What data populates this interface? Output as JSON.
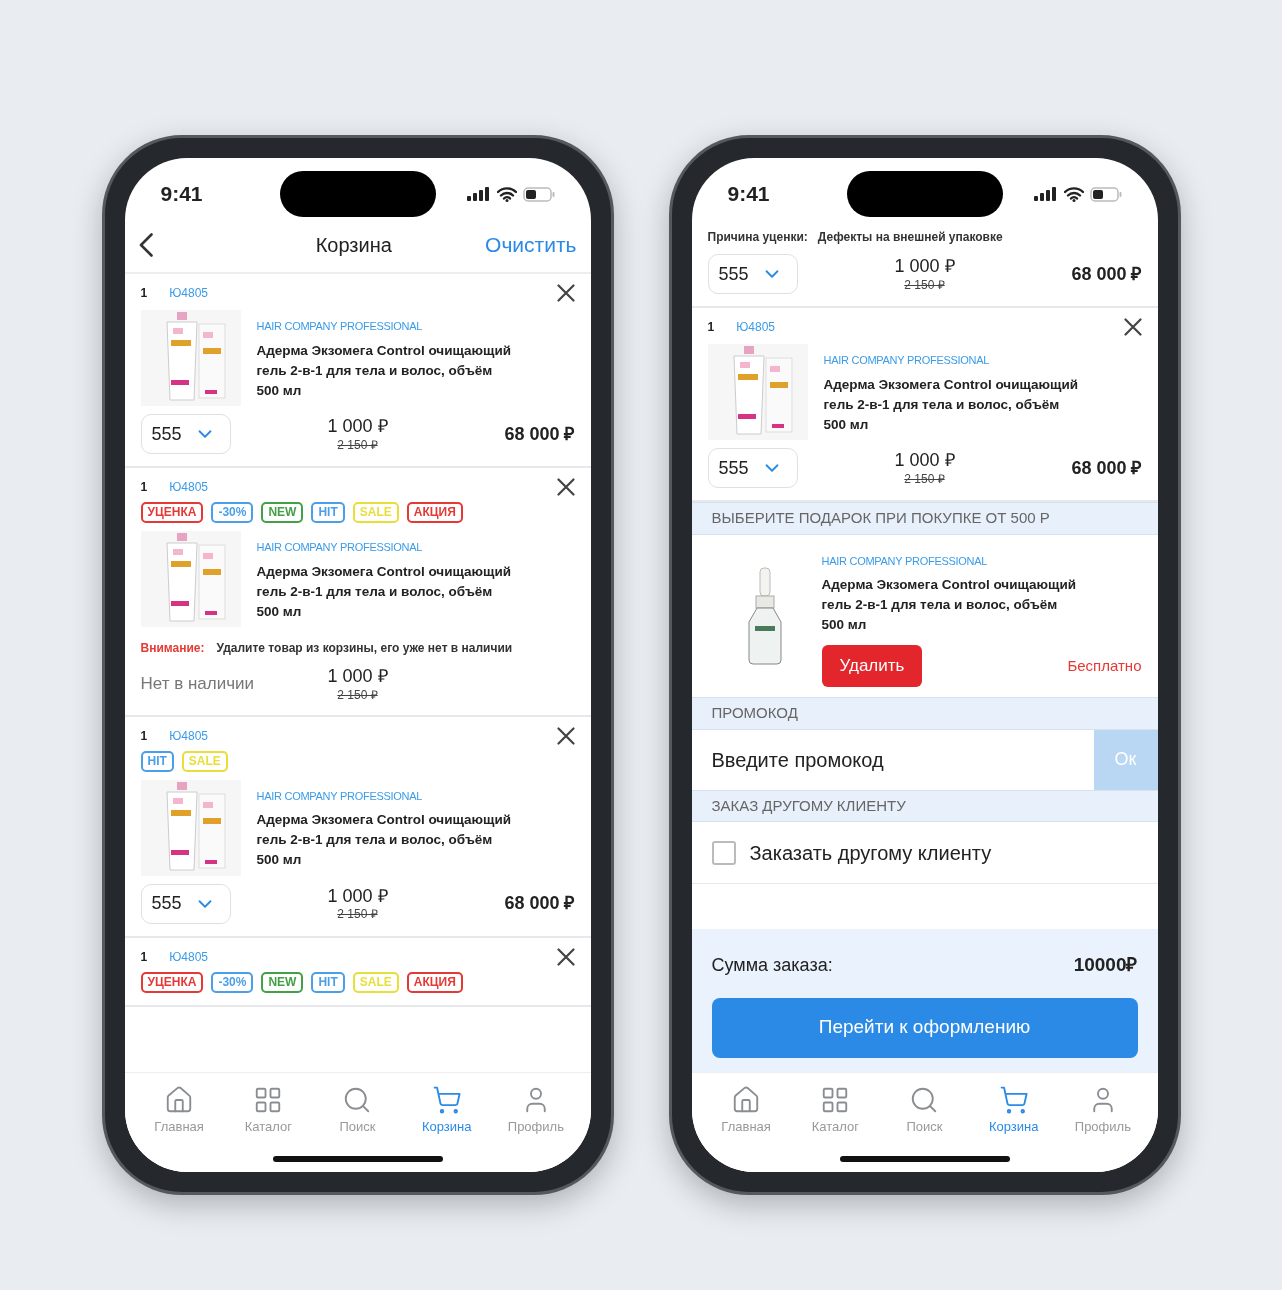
{
  "phones": [
    {
      "status": {
        "time": "9:41"
      },
      "header": {
        "title": "Корзина",
        "action": "Очистить"
      },
      "sections": [
        {
          "kind": "item",
          "number": "1",
          "code": "Ю4805",
          "brand": "HAIR COMPANY PROFESSIONAL",
          "name": "Адерма Экзомега Control очищающий гель 2-в-1 для тела и волос, объём 500 мл",
          "quantity": "555",
          "price": "1 000 ₽",
          "old_price": "2 150 ₽",
          "total": "68 000 ₽"
        },
        {
          "kind": "item",
          "number": "1",
          "code": "Ю4805",
          "tags": [
            {
              "label": "УЦЕНКА",
              "color": "#e53935"
            },
            {
              "label": "-30%",
              "color": "#4a9fe8"
            },
            {
              "label": "NEW",
              "color": "#43a047"
            },
            {
              "label": "HIT",
              "color": "#4a9fe8"
            },
            {
              "label": "SALE",
              "color": "#e8df3a"
            },
            {
              "label": "АКЦИЯ",
              "color": "#e53935"
            }
          ],
          "brand": "HAIR COMPANY PROFESSIONAL",
          "name": "Адерма Экзомега Control очищающий гель 2-в-1 для тела и волос, объём 500 мл",
          "warning_label": "Внимание:",
          "warning": "Удалите товар из корзины, его уже нет в наличии",
          "availability": "Нет в наличии",
          "price": "1 000 ₽",
          "old_price": "2 150 ₽"
        },
        {
          "kind": "item",
          "number": "1",
          "code": "Ю4805",
          "tags": [
            {
              "label": "HIT",
              "color": "#4a9fe8"
            },
            {
              "label": "SALE",
              "color": "#e8df3a"
            }
          ],
          "brand": "HAIR COMPANY PROFESSIONAL",
          "name": "Адерма Экзомега Control очищающий гель 2-в-1 для тела и волос, объём 500 мл",
          "quantity": "555",
          "price": "1 000 ₽",
          "old_price": "2 150 ₽",
          "total": "68 000 ₽"
        },
        {
          "kind": "item",
          "number": "1",
          "code": "Ю4805",
          "tags": [
            {
              "label": "УЦЕНКА",
              "color": "#e53935"
            },
            {
              "label": "-30%",
              "color": "#4a9fe8"
            },
            {
              "label": "NEW",
              "color": "#43a047"
            },
            {
              "label": "HIT",
              "color": "#4a9fe8"
            },
            {
              "label": "SALE",
              "color": "#e8df3a"
            },
            {
              "label": "АКЦИЯ",
              "color": "#e53935"
            }
          ]
        }
      ],
      "tab_bar": [
        {
          "label": "Главная",
          "selected": false
        },
        {
          "label": "Каталог",
          "selected": false
        },
        {
          "label": "Поиск",
          "selected": false
        },
        {
          "label": "Корзина",
          "selected": true
        },
        {
          "label": "Профиль",
          "selected": false
        }
      ]
    },
    {
      "status": {
        "time": "9:41"
      },
      "sections": [
        {
          "kind": "item",
          "reason_label": "Причина уценки:",
          "reason": "Дефекты на внешней упаковке",
          "quantity": "555",
          "price": "1 000 ₽",
          "old_price": "2 150 ₽",
          "total": "68 000 ₽"
        },
        {
          "kind": "item",
          "number": "1",
          "code": "Ю4805",
          "brand": "HAIR COMPANY PROFESSIONAL",
          "name": "Адерма Экзомега Control очищающий гель 2-в-1 для тела и волос, объём 500 мл",
          "quantity": "555",
          "price": "1 000 ₽",
          "old_price": "2 150 ₽",
          "total": "68 000 ₽"
        },
        {
          "kind": "gift",
          "heading": "ВЫБЕРИТЕ ПОДАРОК ПРИ ПОКУПКЕ ОТ 500 Р",
          "brand": "HAIR COMPANY PROFESSIONAL",
          "name": "Адерма Экзомега Control очищающий гель 2-в-1 для тела и волос, объём 500 мл",
          "button": "Удалить",
          "price": "Бесплатно"
        },
        {
          "kind": "promo",
          "heading": "ПРОМОКОД",
          "placeholder": "Введите промокод",
          "button": "Ок"
        },
        {
          "kind": "checkbox",
          "heading": "ЗАКАЗ ДРУГОМУ КЛИЕНТУ",
          "label": "Заказать другому клиенту",
          "checked": false
        },
        {
          "kind": "summary",
          "label": "Сумма заказа:",
          "value": "10000₽",
          "button": "Перейти к оформлению"
        }
      ],
      "tab_bar": [
        {
          "label": "Главная",
          "selected": false
        },
        {
          "label": "Каталог",
          "selected": false
        },
        {
          "label": "Поиск",
          "selected": false
        },
        {
          "label": "Корзина",
          "selected": true
        },
        {
          "label": "Профиль",
          "selected": false
        }
      ]
    }
  ]
}
